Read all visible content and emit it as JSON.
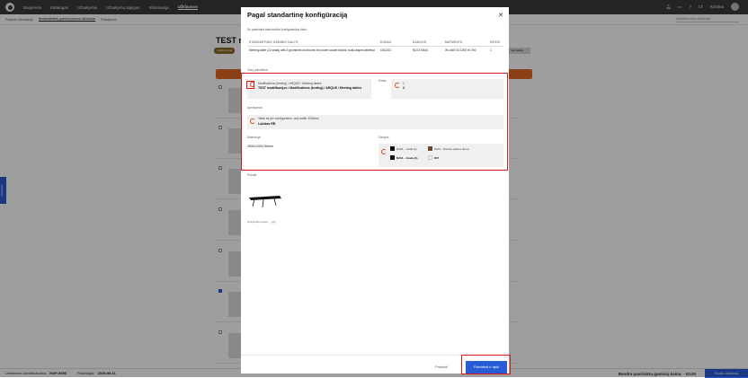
{
  "topnav": {
    "items": [
      "Naujienos",
      "Katalogas",
      "Užsakymai",
      "Užsakymų sąlygos",
      "Informacija",
      "Užklausos"
    ],
    "active_index": 5,
    "lang": "LT",
    "user": "Kristina"
  },
  "subnav": {
    "items": [
      "Projekto informacija",
      "Nestandartinių gaminių kainos užklausos",
      "Pristatymai"
    ],
    "active_index": 1,
    "search_placeholder": "Ieškokite prekių užklausoje"
  },
  "background": {
    "title": "TEST m",
    "pill": "Laukiama pa",
    "right_button": "mendacija",
    "right_button_2": "ndacija"
  },
  "feedback_label": "Feedback",
  "footer": {
    "request_label": "Užklausos identifikatorius:",
    "request_id": "NGF-5450",
    "date_label": "Pasibaigia:",
    "date": "2025-08-11",
    "total": "Bendra pasirinktų gaminių kaina: · €0.00",
    "button": "Siųsti užklausą"
  },
  "modal": {
    "title": "Pagal standartinę konfigūraciją",
    "close_icon": "close-icon",
    "description": "Su pasirinkta standartinio konfigūracijos daliu.",
    "table": {
      "headers": [
        "STANDARTINIO GAMINIO DALYS",
        "KODAS",
        "DANGOS",
        "MATMENYS",
        "KIEKIS"
      ],
      "row": [
        "Meeting table (12 seats) with 3 grommets and boxes for power socket blocks; boat-shaped tabletop",
        "CAQ421",
        "NC01 MA01",
        "W=4300 D=1292 H=760",
        "1"
      ]
    },
    "section_label": "Jūsų pakeitimai",
    "category": {
      "path": "Modifications (testing) / ARQUS / Meeting tables",
      "value": "TEST modifikacijos / Modifications (testing) / ARQUS / Meeting tables"
    },
    "quantity": {
      "label": "Kiekis",
      "old": "1",
      "new": "2"
    },
    "description_field": {
      "label": "Aprašymas",
      "old": "Table as per configuration, only width 4300mm",
      "new": "Lukštas RR"
    },
    "dimensions": {
      "label": "Matmenys",
      "value": "4300x1292x760mm"
    },
    "coatings": {
      "label": "Dangos",
      "old_a": "MA01 – Juoda (A)",
      "old_b": "NC01 – Riešutų spalvos (ketvi)…",
      "new_a": "MA01 – Juoda (A)",
      "new_b": "R07",
      "color_a": "#111111",
      "color_b": "#6b4a2e",
      "color_c": "#f2f2f2"
    },
    "files": {
      "label": "Priedai",
      "filename": "configurator-views-... .jpg"
    },
    "cancel": "Praleisti",
    "confirm": "Patvirtinti ir tęsti"
  }
}
